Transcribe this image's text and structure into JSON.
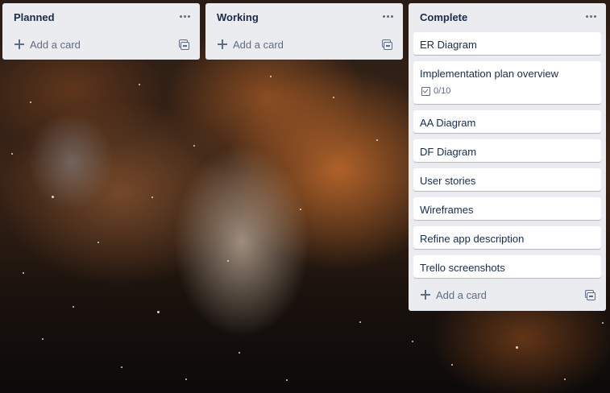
{
  "board": {
    "background": "space-nebula-photo",
    "lists": [
      {
        "title": "Planned",
        "menu_icon": "more-horizontal-icon",
        "add_card_label": "Add a card",
        "cards": []
      },
      {
        "title": "Working",
        "menu_icon": "more-horizontal-icon",
        "add_card_label": "Add a card",
        "cards": []
      },
      {
        "title": "Complete",
        "menu_icon": "more-horizontal-icon",
        "add_card_label": "Add a card",
        "cards": [
          {
            "title": "ER Diagram"
          },
          {
            "title": "Implementation plan overview",
            "checklist": "0/10"
          },
          {
            "title": "AA Diagram"
          },
          {
            "title": "DF Diagram"
          },
          {
            "title": "User stories"
          },
          {
            "title": "Wireframes"
          },
          {
            "title": "Refine app description"
          },
          {
            "title": "Trello screenshots"
          }
        ]
      }
    ]
  },
  "colors": {
    "list_bg": "#ebecf0",
    "card_bg": "#ffffff",
    "text_primary": "#172b4d",
    "text_muted": "#5e6c84"
  }
}
